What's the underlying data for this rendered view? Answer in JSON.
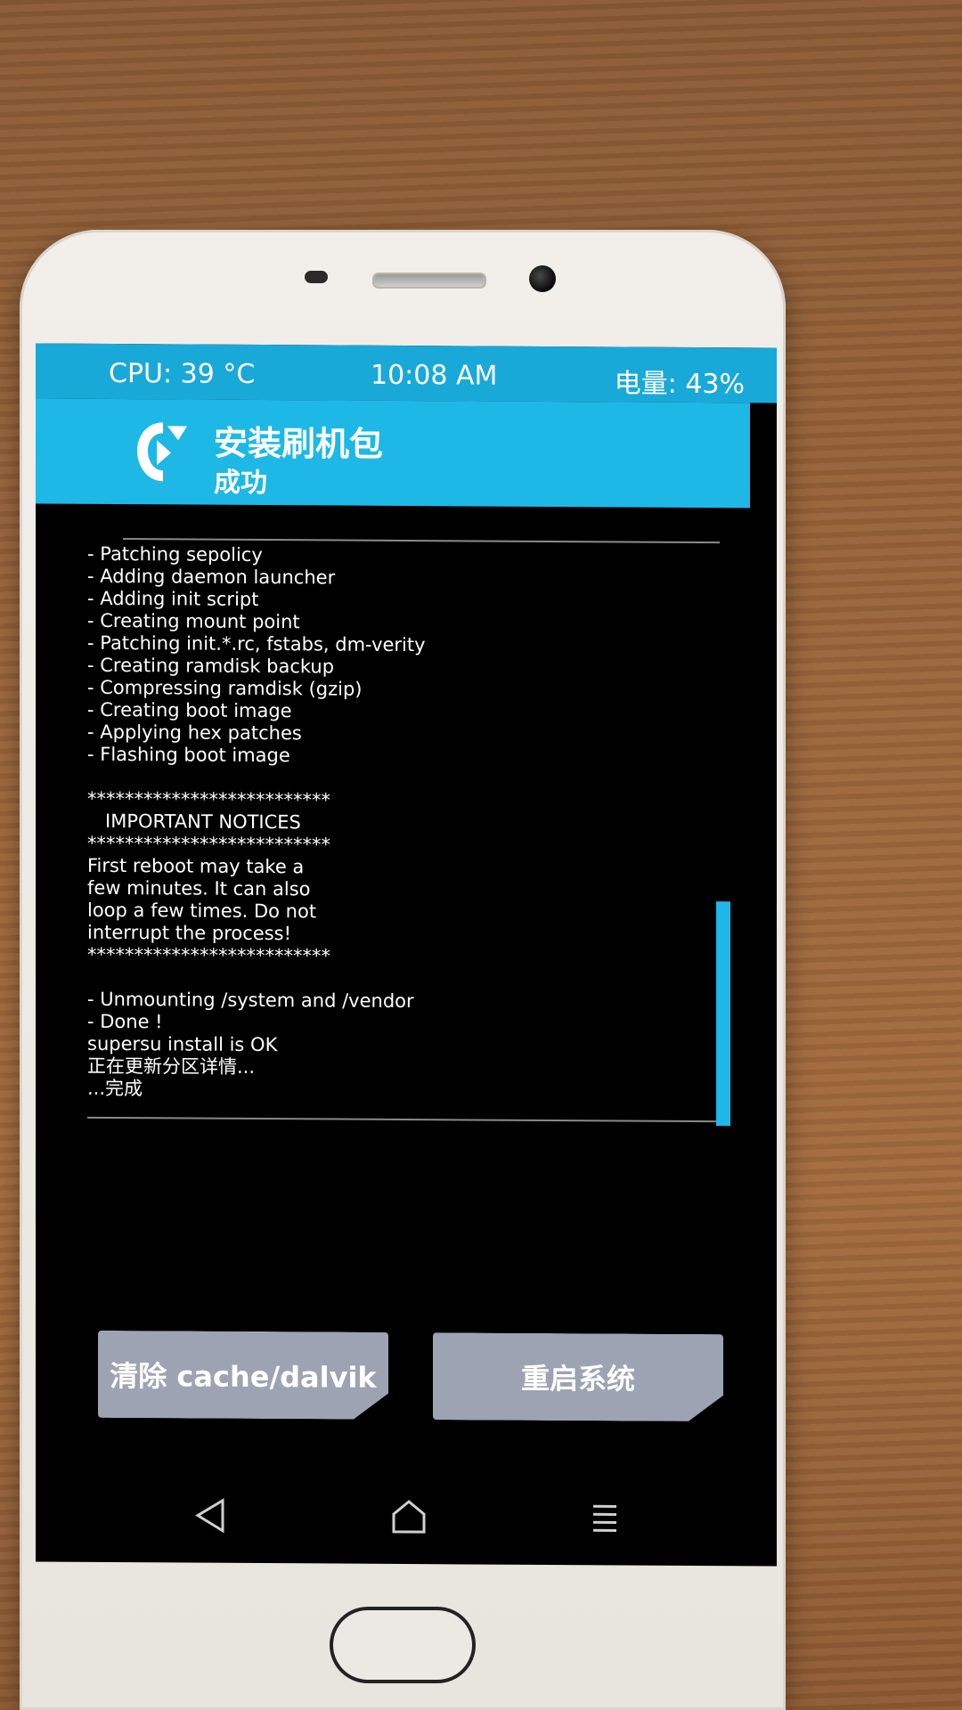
{
  "status_bar": {
    "cpu": "CPU: 39 °C",
    "time": "10:08 AM",
    "battery": "电量: 43%"
  },
  "header": {
    "title": "安装刷机包",
    "subtitle": "成功",
    "logo_icon": "twrp-logo-icon"
  },
  "log": {
    "lines": [
      "- Patching sepolicy",
      "- Adding daemon launcher",
      "- Adding init script",
      "- Creating mount point",
      "- Patching init.*.rc, fstabs, dm-verity",
      "- Creating ramdisk backup",
      "- Compressing ramdisk (gzip)",
      "- Creating boot image",
      "- Applying hex patches",
      "- Flashing boot image",
      "",
      "**************************",
      "   IMPORTANT NOTICES",
      "**************************",
      "First reboot may take a",
      "few minutes. It can also",
      "loop a few times. Do not",
      "interrupt the process!",
      "**************************",
      "",
      "- Unmounting /system and /vendor",
      "- Done !",
      "supersu install is OK",
      "正在更新分区详情...",
      "...完成"
    ]
  },
  "buttons": {
    "wipe_label": "清除 cache/dalvik",
    "reboot_label": "重启系统"
  },
  "nav": {
    "back_icon": "back-triangle-icon",
    "home_icon": "home-icon",
    "menu_icon": "menu-lines-icon"
  },
  "colors": {
    "accent": "#1eb8e6",
    "status_bar": "#19a9d8",
    "button": "#9ea3b3",
    "screen_bg": "#000000"
  }
}
